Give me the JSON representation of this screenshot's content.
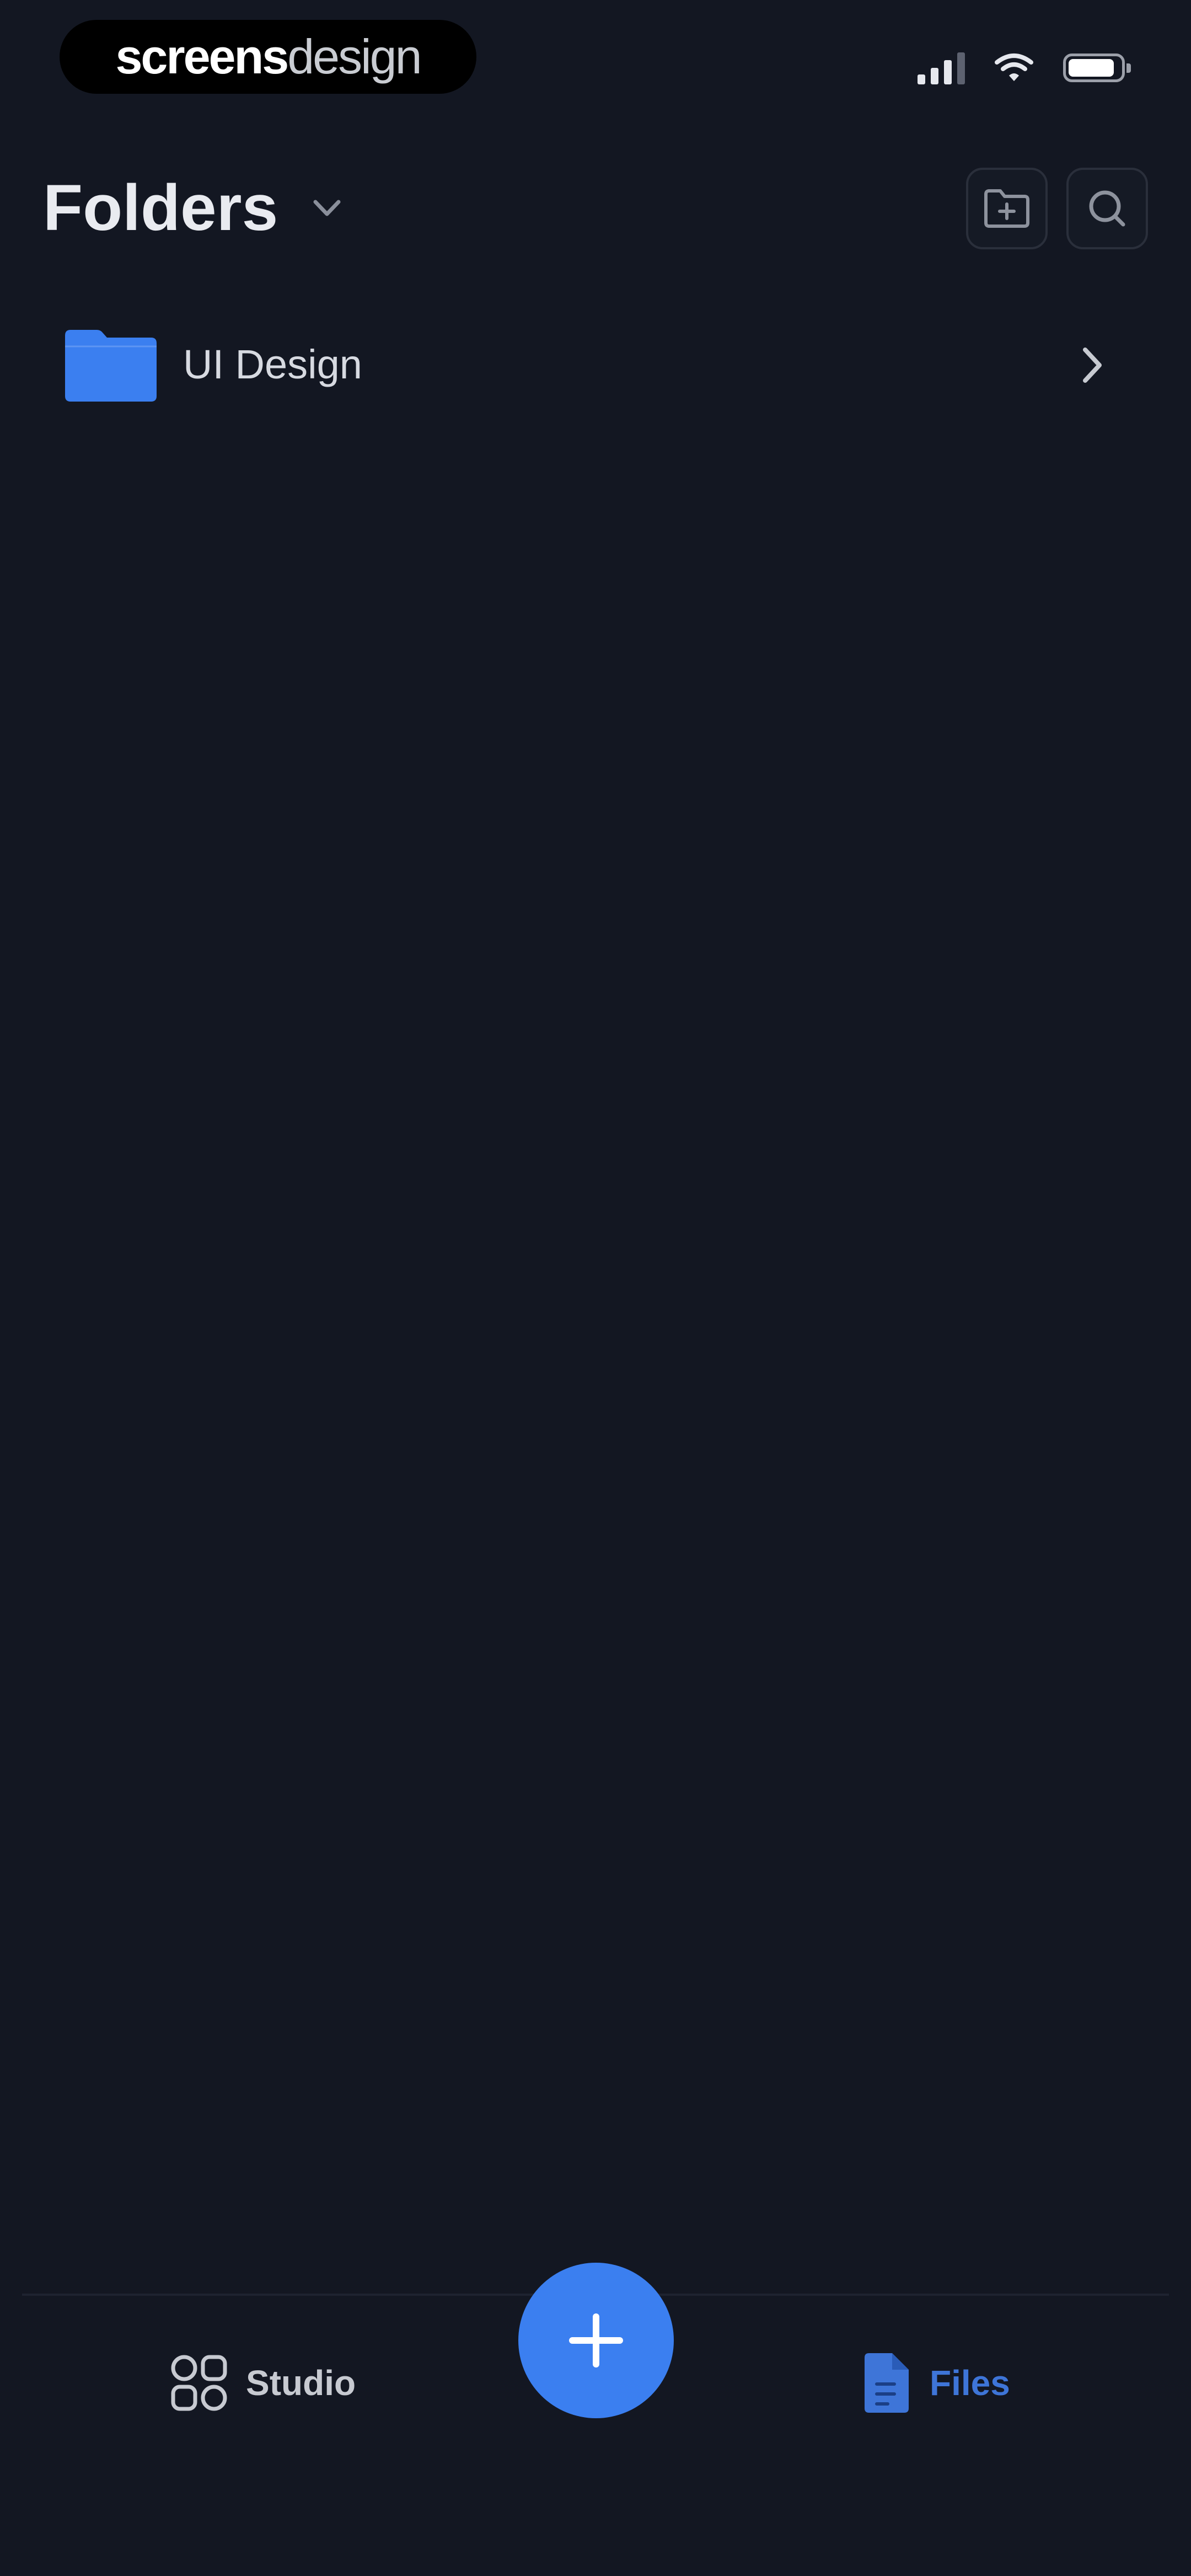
{
  "status_bar": {
    "brand_part1": "screens",
    "brand_part2": "design",
    "icons": [
      "signal-icon",
      "wifi-icon",
      "battery-icon"
    ]
  },
  "header": {
    "title": "Folders",
    "title_icon": "chevron-down-icon",
    "actions": [
      {
        "icon": "new-folder-icon"
      },
      {
        "icon": "search-icon"
      }
    ]
  },
  "folders": [
    {
      "name": "UI Design",
      "icon": "folder-icon",
      "trailing_icon": "chevron-right-icon"
    }
  ],
  "tab_bar": {
    "studio_label": "Studio",
    "files_label": "Files",
    "studio_icon": "grid-icon",
    "files_icon": "file-icon",
    "fab_icon": "plus-icon",
    "active_tab": "Files"
  },
  "colors": {
    "background": "#131722",
    "accent": "#3b7ff0",
    "folder": "#3b7ff0",
    "active_tab_text": "#3e75d8",
    "text_primary": "#e9ebf0"
  }
}
